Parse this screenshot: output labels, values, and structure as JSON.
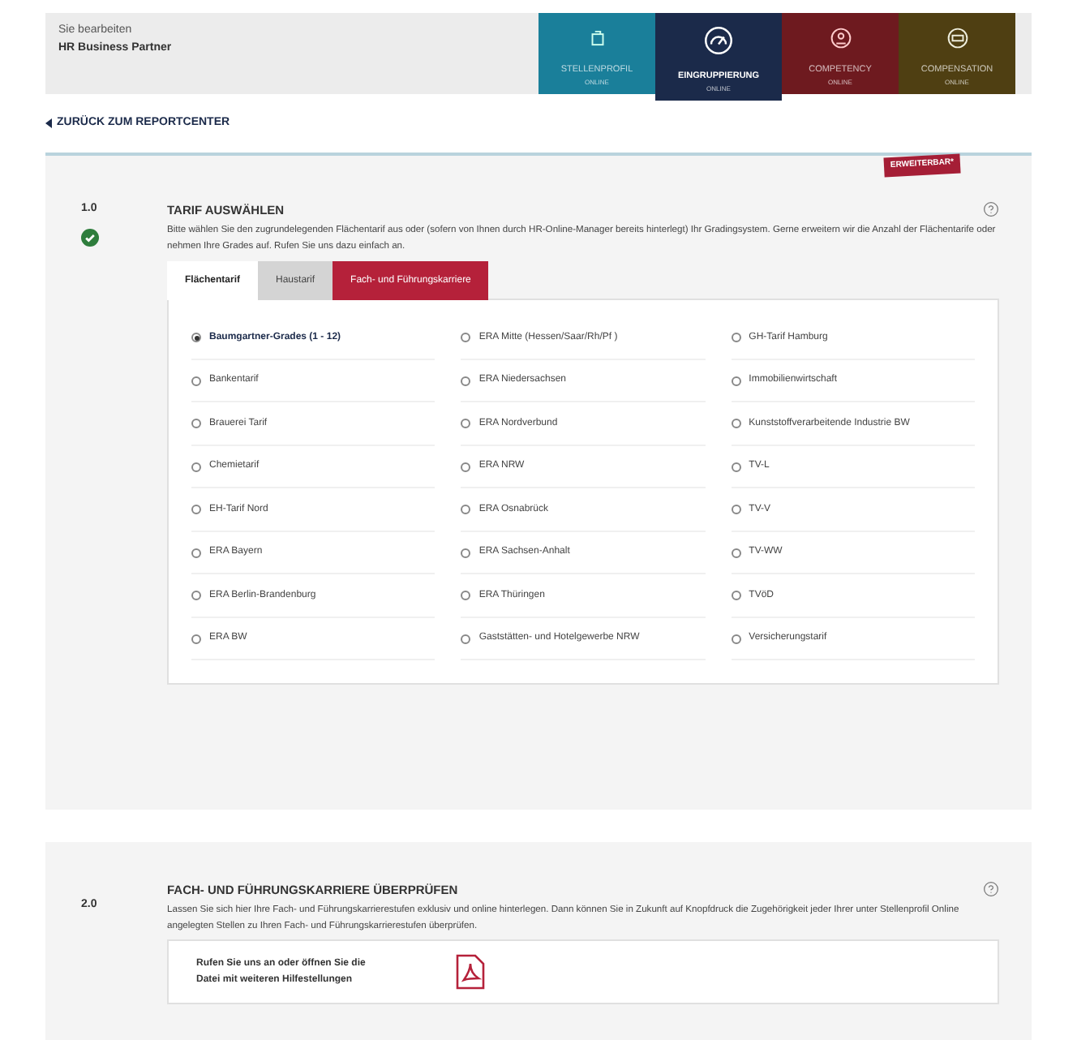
{
  "header": {
    "label": "Sie bearbeiten",
    "name": "HR Business Partner"
  },
  "modules": [
    {
      "kind": "profile",
      "title": "STELLENPROFIL",
      "subtitle": "ONLINE",
      "selected": false,
      "color": "#1a7f9a"
    },
    {
      "kind": "gauge",
      "title": "EINGRUPPIERUNG",
      "subtitle": "ONLINE",
      "selected": true,
      "color": "#1b2a4a"
    },
    {
      "kind": "person",
      "title": "COMPETENCY",
      "subtitle": "ONLINE",
      "selected": false,
      "color": "#6e1a1f"
    },
    {
      "kind": "money",
      "title": "COMPENSATION",
      "subtitle": "ONLINE",
      "selected": false,
      "color": "#4f3f12"
    }
  ],
  "back_link": "ZURÜCK ZUM REPORTCENTER",
  "ribbon": "ERWEITERBAR*",
  "section1": {
    "number": "1.0",
    "title": "TARIF AUSWÄHLEN",
    "done": true,
    "text": "Bitte wählen Sie den zugrundelegenden Flächentarif aus oder (sofern von Ihnen durch HR-Online-Manager bereits hinterlegt) Ihr Gradingsystem. Gerne erweitern wir die Anzahl der Flächentarife oder nehmen Ihre Grades auf. Rufen Sie uns dazu einfach an.",
    "tabs": [
      {
        "label": "Flächentarif",
        "selected": true,
        "kind": "plain"
      },
      {
        "label": "Haustarif",
        "selected": false,
        "kind": "plain"
      },
      {
        "label": "Fach- und Führungskarriere",
        "selected": false,
        "kind": "accent"
      }
    ],
    "columns": [
      [
        {
          "label": "Baumgartner-Grades (1 - 12)",
          "selected": true
        },
        {
          "label": "Bankentarif",
          "selected": false
        },
        {
          "label": "Brauerei Tarif",
          "selected": false
        },
        {
          "label": "Chemietarif",
          "selected": false
        },
        {
          "label": "EH-Tarif Nord",
          "selected": false
        },
        {
          "label": "ERA Bayern",
          "selected": false
        },
        {
          "label": "ERA Berlin-Brandenburg",
          "selected": false
        },
        {
          "label": "ERA BW",
          "selected": false
        }
      ],
      [
        {
          "label": "ERA Mitte (Hessen/Saar/Rh/Pf )",
          "selected": false
        },
        {
          "label": "ERA Niedersachsen",
          "selected": false
        },
        {
          "label": "ERA Nordverbund",
          "selected": false
        },
        {
          "label": "ERA NRW",
          "selected": false
        },
        {
          "label": "ERA Osnabrück",
          "selected": false
        },
        {
          "label": "ERA Sachsen-Anhalt",
          "selected": false
        },
        {
          "label": "ERA Thüringen",
          "selected": false
        },
        {
          "label": "Gaststätten- und Hotelgewerbe NRW",
          "selected": false
        }
      ],
      [
        {
          "label": "GH-Tarif Hamburg",
          "selected": false
        },
        {
          "label": "Immobilienwirtschaft",
          "selected": false
        },
        {
          "label": "Kunststoffverarbeitende Industrie BW",
          "selected": false
        },
        {
          "label": "TV-L",
          "selected": false
        },
        {
          "label": "TV-V",
          "selected": false
        },
        {
          "label": "TV-WW",
          "selected": false
        },
        {
          "label": "TVöD",
          "selected": false
        },
        {
          "label": "Versicherungstarif",
          "selected": false
        }
      ]
    ]
  },
  "section2": {
    "number": "2.0",
    "title": "FACH- UND FÜHRUNGSKARRIERE ÜBERPRÜFEN",
    "text": "Lassen Sie sich hier Ihre Fach- und Führungskarrierestufen exklusiv und online hinterlegen. Dann können Sie in Zukunft auf Knopfdruck die Zugehörigkeit jeder Ihrer unter Stellenprofil Online angelegten Stellen zu Ihren Fach- und Führungskarrierestufen überprüfen.",
    "help": "Rufen Sie uns an oder öffnen Sie die Datei mit weiteren Hilfestellungen"
  }
}
